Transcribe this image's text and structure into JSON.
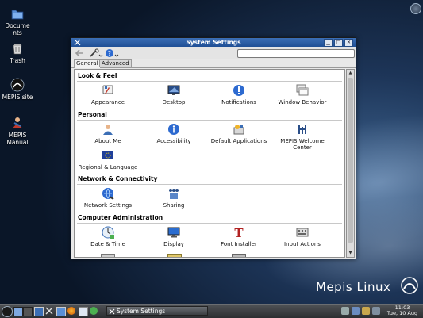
{
  "desktop": {
    "icons": [
      {
        "label": "Docume nts",
        "icon": "folder-icon"
      },
      {
        "label": "Trash",
        "icon": "trash-icon"
      },
      {
        "label": "MEPIS site",
        "icon": "mepis-site-icon"
      },
      {
        "label": "MEPIS Manual",
        "icon": "manual-icon"
      }
    ],
    "brand": "Mepis Linux",
    "colors": {
      "accent": "#1f4f95",
      "background": "#1d3558"
    }
  },
  "window": {
    "title": "System Settings",
    "search_placeholder": "",
    "tabs": [
      {
        "label": "General",
        "active": true
      },
      {
        "label": "Advanced",
        "active": false
      }
    ],
    "sections": [
      {
        "title": "Look & Feel",
        "items": [
          "Appearance",
          "Desktop",
          "Notifications",
          "Window Behavior"
        ]
      },
      {
        "title": "Personal",
        "items": [
          "About Me",
          "Accessibility",
          "Default Applications",
          "MEPIS Welcome Center",
          "Regional & Language"
        ]
      },
      {
        "title": "Network & Connectivity",
        "items": [
          "Network Settings",
          "Sharing"
        ]
      },
      {
        "title": "Computer Administration",
        "items": [
          "Date & Time",
          "Display",
          "Font Installer",
          "Input Actions"
        ]
      }
    ]
  },
  "taskbar": {
    "task_label": "System Settings",
    "clock_time": "11:03",
    "clock_date": "Tue, 10 Aug"
  }
}
